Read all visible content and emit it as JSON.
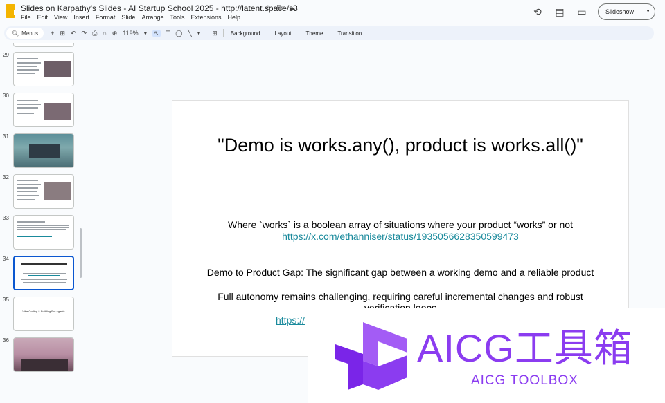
{
  "header": {
    "doc_title": "Slides on Karpathy's Slides - AI Startup School 2025 - http://latent.space/s3",
    "title_icons": [
      "☆",
      "⧉",
      "☁"
    ],
    "menu": [
      "File",
      "Edit",
      "View",
      "Insert",
      "Format",
      "Slide",
      "Arrange",
      "Tools",
      "Extensions",
      "Help"
    ],
    "slideshow_label": "Slideshow",
    "right_icons": [
      "⟲",
      "▤",
      "▭"
    ]
  },
  "toolbar": {
    "menus_label": "Menus",
    "zoom": "119%",
    "background": "Background",
    "layout": "Layout",
    "theme": "Theme",
    "transition": "Transition"
  },
  "filmstrip": {
    "slides": [
      {
        "number": "29"
      },
      {
        "number": "30"
      },
      {
        "number": "31"
      },
      {
        "number": "32"
      },
      {
        "number": "33"
      },
      {
        "number": "34"
      },
      {
        "number": "35",
        "text": "Vibe Coding & Building For Agents"
      },
      {
        "number": "36"
      }
    ],
    "selected_index": 5
  },
  "slide": {
    "title": "\"Demo is works.any(), product is works.all()\"",
    "para1": "Where `works` is a boolean array of situations where your product “works” or not",
    "link1": "https://x.com/ethanniser/status/1935056628350599473",
    "para2": "Demo to Product Gap: The significant gap between a working demo and a reliable product",
    "para3": "Full autonomy remains challenging, requiring careful incremental changes and robust",
    "para3_cont": "verification loops",
    "link2": "https://"
  },
  "watermark": {
    "text": "AICG工具箱",
    "subtext": "AICG TOOLBOX",
    "color": "#8b3cf0"
  }
}
